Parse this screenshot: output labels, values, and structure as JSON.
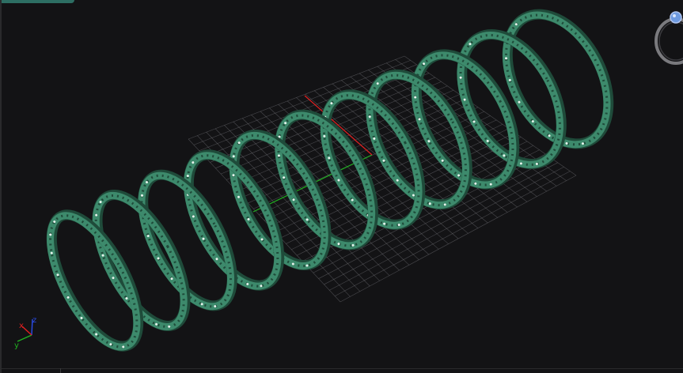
{
  "app": {
    "viewport_label": "",
    "accent_color": "#2d6e63"
  },
  "scene": {
    "background_color": "#131315",
    "object_color": "#3d8a6c",
    "object_dark_color": "#1f4b3a",
    "highlight_color": "#e8f5ee",
    "grid_color": "#8a8a90",
    "bangle_count": 11,
    "grid_visible": true
  },
  "axis_gizmo": {
    "x_label": "x",
    "y_label": "y",
    "z_label": "z",
    "x_color": "#e02020",
    "y_color": "#20b020",
    "z_color": "#2a4ae0"
  },
  "icons": {
    "nav_gizmo": "ring-preview-icon",
    "axis_gizmo": "axis-triad-icon"
  }
}
